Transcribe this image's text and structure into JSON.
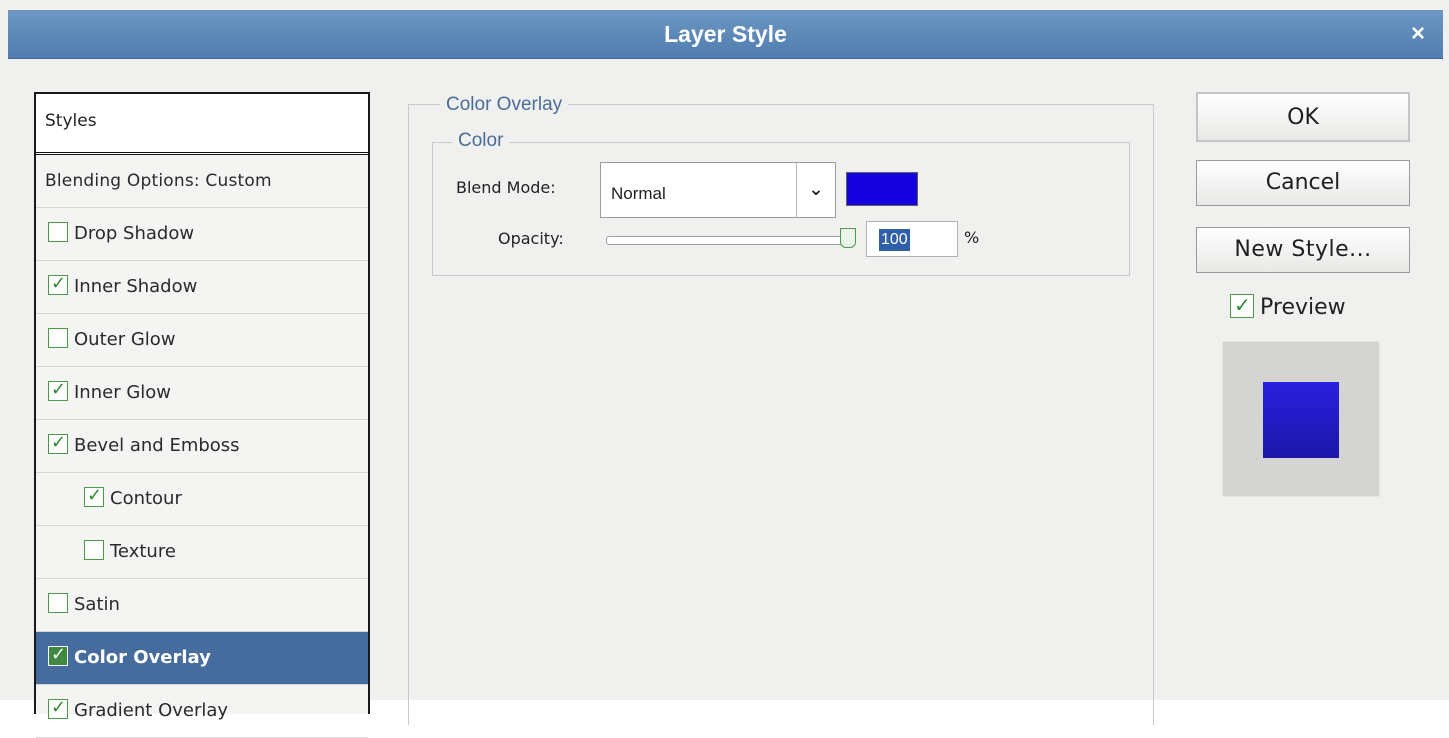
{
  "window": {
    "title": "Layer Style",
    "close_label": "×"
  },
  "styles_panel": {
    "header": "Styles",
    "blending": "Blending Options: Custom",
    "items": [
      {
        "label": "Drop Shadow",
        "checked": false,
        "indent": false,
        "selected": false
      },
      {
        "label": "Inner Shadow",
        "checked": true,
        "indent": false,
        "selected": false
      },
      {
        "label": "Outer Glow",
        "checked": false,
        "indent": false,
        "selected": false
      },
      {
        "label": "Inner Glow",
        "checked": true,
        "indent": false,
        "selected": false
      },
      {
        "label": "Bevel and Emboss",
        "checked": true,
        "indent": false,
        "selected": false
      },
      {
        "label": "Contour",
        "checked": true,
        "indent": true,
        "selected": false
      },
      {
        "label": "Texture",
        "checked": false,
        "indent": true,
        "selected": false
      },
      {
        "label": "Satin",
        "checked": false,
        "indent": false,
        "selected": false
      },
      {
        "label": "Color Overlay",
        "checked": true,
        "indent": false,
        "selected": true
      },
      {
        "label": "Gradient Overlay",
        "checked": true,
        "indent": false,
        "selected": false
      }
    ]
  },
  "color_overlay": {
    "section_title": "Color Overlay",
    "group_title": "Color",
    "blend_mode_label": "Blend Mode:",
    "blend_mode_value": "Normal",
    "overlay_color": "#1500e0",
    "opacity_label": "Opacity:",
    "opacity_value": "100",
    "opacity_unit": "%",
    "opacity_level": 1.0
  },
  "buttons": {
    "ok": "OK",
    "cancel": "Cancel",
    "new_style": "New Style..."
  },
  "preview": {
    "label": "Preview",
    "checked": true
  },
  "colors": {
    "titlebar": "#5a86b8",
    "selected_row": "#466c9e",
    "checkbox_green": "#2f8a2f",
    "legend_blue": "#4a6c9a"
  }
}
